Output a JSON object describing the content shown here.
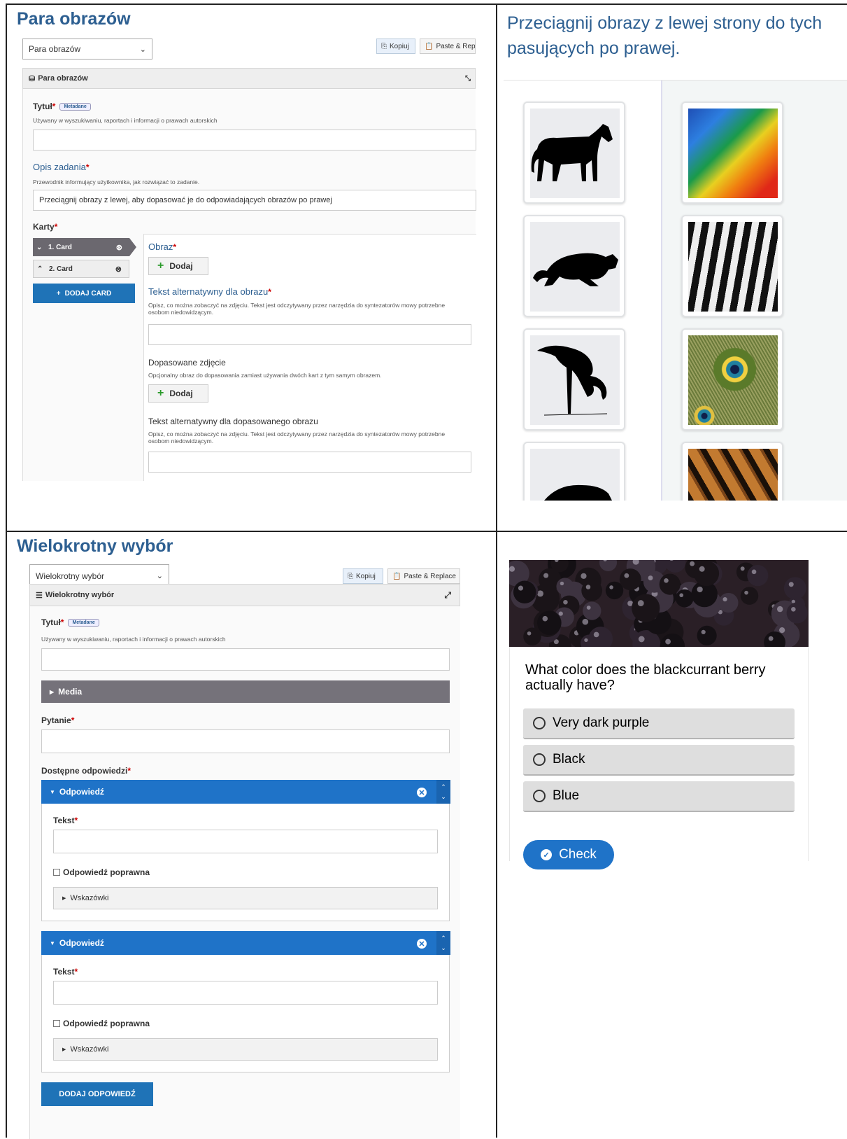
{
  "image_pairing": {
    "section_title": "Para obrazów",
    "hint": "Przeciągnij obrazy z lewej strony do tych pasujących po prawej.",
    "editor": {
      "select_value": "Para obrazów",
      "copy_label": "Kopiuj",
      "paste_label": "Paste & Repl",
      "header_label": "Para obrazów",
      "title_label": "Tytuł",
      "metadata_badge": "Metadane",
      "title_desc": "Używany w wyszukiwaniu, raportach i informacji o prawach autorskich",
      "task_label": "Opis zadania",
      "task_desc": "Przewodnik informujący użytkownika, jak rozwiązać to zadanie.",
      "task_value": "Przeciągnij obrazy z lewej, aby dopasować je do odpowiadających obrazów po prawej",
      "cards_label": "Karty",
      "cards": [
        {
          "label": "1. Card"
        },
        {
          "label": "2. Card"
        }
      ],
      "add_card_label": "DODAJ CARD",
      "image_label": "Obraz",
      "add_label": "Dodaj",
      "alt_label": "Tekst alternatywny dla obrazu",
      "alt_desc": "Opisz, co można zobaczyć na zdjęciu. Tekst jest odczytywany przez narzędzia do syntezatorów mowy potrzebne osobom niedowidzącym.",
      "match_label": "Dopasowane zdjęcie",
      "match_desc": "Opcjonalny obraz do dopasowania zamiast używania dwóch kart z tym samym obrazem.",
      "match_add_label": "Dodaj",
      "match_alt_label": "Tekst alternatywny dla dopasowanego obrazu",
      "match_alt_desc": "Opisz, co można zobaczyć na zdjęciu. Tekst jest odczytywany przez narzędzia do syntezatorów mowy potrzebne osobom niedowidzącym."
    },
    "preview": {
      "left_images": [
        "horse-silhouette",
        "panther-silhouette",
        "flamingo-silhouette",
        "tiger-silhouette"
      ],
      "right_images": [
        "parrot-feathers",
        "zebra-stripes",
        "peacock-feather",
        "tiger-fur"
      ]
    }
  },
  "multiple_choice": {
    "section_title": "Wielokrotny wybór",
    "editor": {
      "select_value": "Wielokrotny wybór",
      "copy_label": "Kopiuj",
      "paste_label": "Paste & Replace",
      "header_label": "Wielokrotny wybór",
      "title_label": "Tytuł",
      "metadata_badge": "Metadane",
      "title_desc": "Używany w wyszukiwaniu, raportach i informacji o prawach autorskich",
      "media_label": "Media",
      "question_label": "Pytanie",
      "answers_label": "Dostępne odpowiedzi",
      "answers": [
        {
          "bar_label": "Odpowiedź",
          "text_label": "Tekst",
          "correct_label": "Odpowiedź poprawna",
          "tips_label": "Wskazówki"
        },
        {
          "bar_label": "Odpowiedź",
          "text_label": "Tekst",
          "correct_label": "Odpowiedź poprawna",
          "tips_label": "Wskazówki"
        }
      ],
      "add_answer_label": "DODAJ ODPOWIEDŹ"
    },
    "preview": {
      "question": "What color does the blackcurrant berry actually have?",
      "options": [
        "Very dark purple",
        "Black",
        "Blue"
      ],
      "check_label": "Check"
    }
  },
  "colors": {
    "accent": "#1f73c8",
    "title": "#2d5f91",
    "required": "#cc0000"
  }
}
